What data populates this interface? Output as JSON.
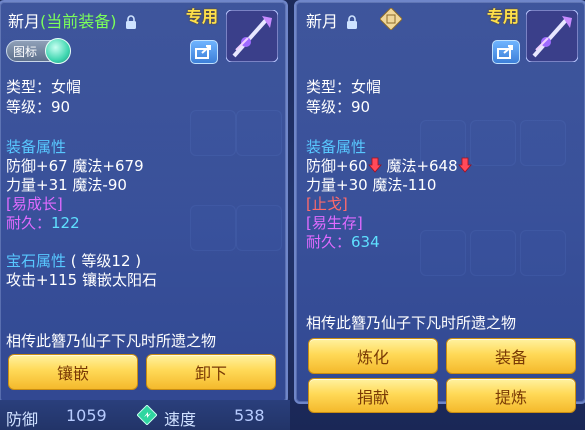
{
  "left_panel": {
    "title": "新月",
    "title_current": "(当前装备)",
    "special_label": "专用",
    "toggle_label": "图标",
    "type_line": "类型：女帽",
    "level_line": "等级：90",
    "attr_header": "装备属性",
    "attr_line1": "防御+67 魔法+679",
    "attr_line2": "力量+31 魔法-90",
    "tag1": "[易成长]",
    "durability_label": "耐久：",
    "durability_value": "122",
    "gem_header": "宝石属性",
    "gem_level": "( 等级12 )",
    "gem_line": "攻击+115 镶嵌太阳石",
    "description": "相传此簪乃仙子下凡时所遗之物",
    "buttons": [
      "镶嵌",
      "卸下"
    ]
  },
  "right_panel": {
    "title": "新月",
    "special_label": "专用",
    "type_line": "类型：女帽",
    "level_line": "等级：90",
    "attr_header": "装备属性",
    "attr_defense": "防御+60",
    "attr_magic": "魔法+648",
    "attr_line2": "力量+30 魔法-110",
    "tag_red": "[止戈]",
    "tag_purple": "[易生存]",
    "durability_label": "耐久：",
    "durability_value": "634",
    "description": "相传此簪乃仙子下凡时所遗之物",
    "buttons": [
      "炼化",
      "装备",
      "捐献",
      "提炼"
    ]
  },
  "bottom_stats": {
    "defense_label": "防御",
    "defense_value": "1059",
    "speed_label": "速度",
    "speed_value": "538"
  },
  "icons": [
    "lock-icon",
    "share-icon",
    "weapon-hairpin-icon",
    "seal-icon",
    "down-arrow-icon",
    "speed-icon"
  ],
  "colors": {
    "button_gold": "#ffd957",
    "current_equip_green": "#7bff5a",
    "header_blue": "#58c8ff",
    "tag_purple": "#e06bff",
    "tag_red": "#ff6a6a",
    "special_yellow": "#ffe14a"
  }
}
